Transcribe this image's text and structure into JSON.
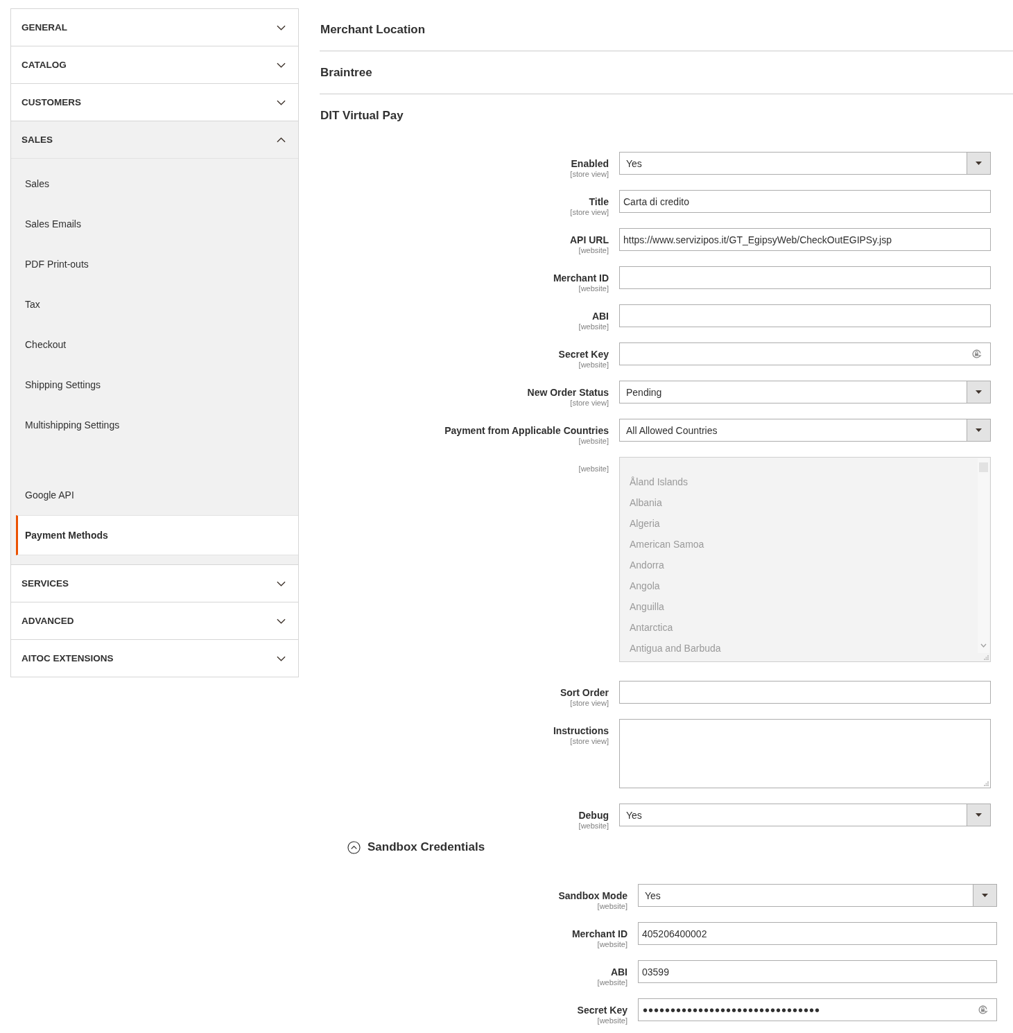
{
  "sidebar": {
    "sections": [
      {
        "label": "GENERAL",
        "expanded": false
      },
      {
        "label": "CATALOG",
        "expanded": false
      },
      {
        "label": "CUSTOMERS",
        "expanded": false
      },
      {
        "label": "SALES",
        "expanded": true,
        "items": [
          {
            "kind": "link",
            "label": "Sales",
            "selected": false
          },
          {
            "kind": "link",
            "label": "Sales Emails",
            "selected": false
          },
          {
            "kind": "link",
            "label": "PDF Print-outs",
            "selected": false
          },
          {
            "kind": "link",
            "label": "Tax",
            "selected": false
          },
          {
            "kind": "link",
            "label": "Checkout",
            "selected": false
          },
          {
            "kind": "link",
            "label": "Shipping Settings",
            "selected": false
          },
          {
            "kind": "link",
            "label": "Multishipping Settings",
            "selected": false
          },
          {
            "kind": "hidden"
          },
          {
            "kind": "link",
            "label": "Google API",
            "selected": false
          },
          {
            "kind": "link",
            "label": "Payment Methods",
            "selected": true
          }
        ]
      },
      {
        "label": "SERVICES",
        "expanded": false
      },
      {
        "label": "ADVANCED",
        "expanded": false
      },
      {
        "label": "AITOC EXTENSIONS",
        "expanded": false
      }
    ]
  },
  "sections": [
    {
      "title": "Merchant Location",
      "expanded": false
    },
    {
      "title": "Braintree",
      "expanded": false
    },
    {
      "title": "DIT Virtual Pay",
      "expanded": true,
      "fields": [
        {
          "label": "Enabled",
          "scope": "[store view]",
          "kind": "select",
          "value": "Yes"
        },
        {
          "label": "Title",
          "scope": "[store view]",
          "kind": "text",
          "value": "Carta di credito"
        },
        {
          "label": "API URL",
          "scope": "[website]",
          "kind": "text",
          "value": "https://www.servizipos.it/GT_EgipsyWeb/CheckOutEGIPSy.jsp"
        },
        {
          "label": "Merchant ID",
          "scope": "[website]",
          "kind": "text"
        },
        {
          "label": "ABI",
          "scope": "[website]",
          "kind": "text"
        },
        {
          "label": "Secret Key",
          "scope": "[website]",
          "kind": "password"
        },
        {
          "label": "New Order Status",
          "scope": "[store view]",
          "kind": "select",
          "value": "Pending"
        },
        {
          "label": "Payment from Applicable Countries",
          "scope": "[website]",
          "kind": "select",
          "value": "All Allowed Countries"
        },
        {
          "scope": "[website]",
          "kind": "multiselect",
          "disabled": true,
          "options": [
            "Åland Islands",
            "Albania",
            "Algeria",
            "American Samoa",
            "Andorra",
            "Angola",
            "Anguilla",
            "Antarctica",
            "Antigua and Barbuda"
          ]
        },
        {
          "label": "Sort Order",
          "scope": "[store view]",
          "kind": "text"
        },
        {
          "label": "Instructions",
          "scope": "[store view]",
          "kind": "textarea"
        },
        {
          "label": "Debug",
          "scope": "[website]",
          "kind": "select",
          "value": "Yes"
        }
      ],
      "groups": [
        {
          "title": "Sandbox Credentials",
          "expanded": true,
          "fields": [
            {
              "label": "Sandbox Mode",
              "scope": "[website]",
              "kind": "select",
              "value": "Yes"
            },
            {
              "label": "Merchant ID",
              "scope": "[website]",
              "kind": "text",
              "value": "405206400002"
            },
            {
              "label": "ABI",
              "scope": "[website]",
              "kind": "text",
              "value": "03599"
            },
            {
              "label": "Secret Key",
              "scope": "[website]",
              "kind": "password",
              "value": "••••••••••••••••••••••••••••••••"
            }
          ]
        }
      ]
    }
  ]
}
